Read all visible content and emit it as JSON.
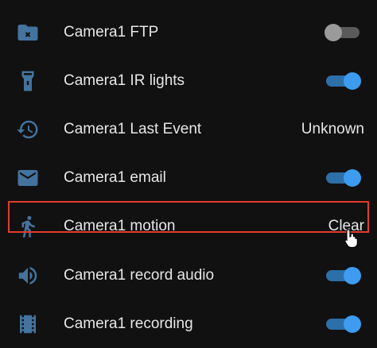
{
  "entities": [
    {
      "id": "ftp",
      "label": "Camera1 FTP",
      "icon": "folder-remove-icon",
      "control": "toggle",
      "toggle_on": false
    },
    {
      "id": "ir",
      "label": "Camera1 IR lights",
      "icon": "flashlight-icon",
      "control": "toggle",
      "toggle_on": true
    },
    {
      "id": "last-event",
      "label": "Camera1 Last Event",
      "icon": "history-icon",
      "control": "text",
      "state": "Unknown"
    },
    {
      "id": "email",
      "label": "Camera1 email",
      "icon": "email-icon",
      "control": "toggle",
      "toggle_on": true
    },
    {
      "id": "motion",
      "label": "Camera1 motion",
      "icon": "walk-icon",
      "control": "text",
      "state": "Clear",
      "highlighted": true
    },
    {
      "id": "record-audio",
      "label": "Camera1 record audio",
      "icon": "volume-icon",
      "control": "toggle",
      "toggle_on": true
    },
    {
      "id": "recording",
      "label": "Camera1 recording",
      "icon": "filmstrip-icon",
      "control": "toggle",
      "toggle_on": true
    }
  ],
  "colors": {
    "background": "#111111",
    "icon": "#44739e",
    "toggle_on": "#3d9cf0",
    "toggle_off": "#9a9a9a",
    "highlight_border": "#e23c2e"
  }
}
